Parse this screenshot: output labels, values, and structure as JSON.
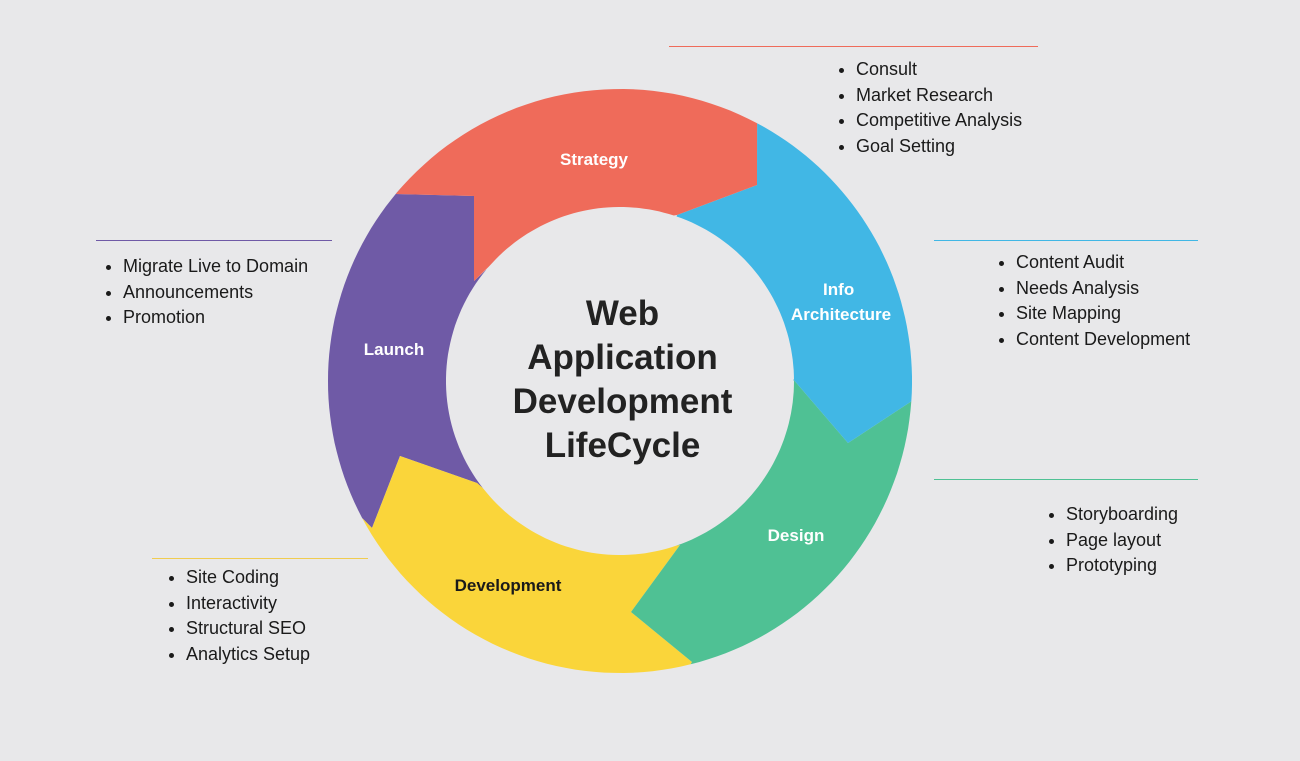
{
  "title_lines": [
    "Web",
    "Application",
    "Development",
    "LifeCycle"
  ],
  "colors": {
    "strategy": "#ef6b5a",
    "info_architecture": "#41b7e5",
    "design": "#4fc194",
    "development": "#fad53a",
    "launch": "#6f5aa6",
    "background": "#e8e8ea",
    "text": "#1a1a1a"
  },
  "stages": [
    {
      "id": "strategy",
      "label_lines": [
        "Strategy"
      ],
      "label_color": "#ffffff",
      "items": [
        "Consult",
        "Market Research",
        "Competitive Analysis",
        "Goal Setting"
      ],
      "rule_color": "#ef6b5a"
    },
    {
      "id": "info_architecture",
      "label_lines": [
        "Info",
        "Architecture"
      ],
      "label_color": "#ffffff",
      "items": [
        "Content Audit",
        "Needs Analysis",
        "Site Mapping",
        "Content Development"
      ],
      "rule_color": "#41b7e5"
    },
    {
      "id": "design",
      "label_lines": [
        "Design"
      ],
      "label_color": "#ffffff",
      "items": [
        "Storyboarding",
        "Page layout",
        "Prototyping"
      ],
      "rule_color": "#4fc194"
    },
    {
      "id": "development",
      "label_lines": [
        "Development"
      ],
      "label_color": "#1a1a1a",
      "items": [
        "Site Coding",
        "Interactivity",
        "Structural SEO",
        "Analytics Setup"
      ],
      "rule_color": "#f0cc50"
    },
    {
      "id": "launch",
      "label_lines": [
        "Launch"
      ],
      "label_color": "#ffffff",
      "items": [
        "Migrate Live to Domain",
        "Announcements",
        "Promotion"
      ],
      "rule_color": "#6f5aa6"
    }
  ]
}
